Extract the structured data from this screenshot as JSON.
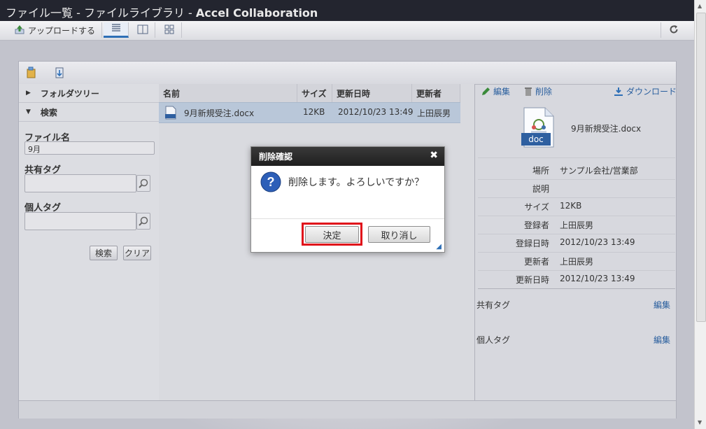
{
  "window": {
    "title_prefix": "ファイル一覧 - ファイルライブラリ - ",
    "title_app": "Accel Collaboration"
  },
  "toolbar": {
    "upload_label": "アップロードする"
  },
  "sidebar": {
    "folder_tree_label": "フォルダツリー",
    "search_label": "検索",
    "file_name_label": "ファイル名",
    "file_name_value": "9月",
    "shared_tag_label": "共有タグ",
    "personal_tag_label": "個人タグ",
    "search_button": "検索",
    "clear_button": "クリア"
  },
  "grid": {
    "columns": [
      "名前",
      "サイズ",
      "更新日時",
      "更新者"
    ],
    "rows": [
      {
        "name": "9月新規受注.docx",
        "size": "12KB",
        "updated": "2012/10/23 13:49",
        "updater": "上田辰男"
      }
    ]
  },
  "detail": {
    "edit_label": "編集",
    "delete_label": "削除",
    "download_label": "ダウンロード",
    "file_type": "doc",
    "file_name": "9月新規受注.docx",
    "properties": [
      {
        "key": "場所",
        "value": "サンプル会社/営業部"
      },
      {
        "key": "説明",
        "value": ""
      },
      {
        "key": "サイズ",
        "value": "12KB"
      },
      {
        "key": "登録者",
        "value": "上田辰男"
      },
      {
        "key": "登録日時",
        "value": "2012/10/23 13:49"
      },
      {
        "key": "更新者",
        "value": "上田辰男"
      },
      {
        "key": "更新日時",
        "value": "2012/10/23 13:49"
      }
    ],
    "shared_tag_label": "共有タグ",
    "personal_tag_label": "個人タグ",
    "tag_edit_label": "編集"
  },
  "dialog": {
    "title": "削除確認",
    "message": "削除します。よろしいですか？",
    "ok_label": "決定",
    "cancel_label": "取り消し"
  },
  "colors": {
    "accent": "#2e6fb6",
    "highlight": "#e0101a",
    "titlebar": "#23252f"
  }
}
